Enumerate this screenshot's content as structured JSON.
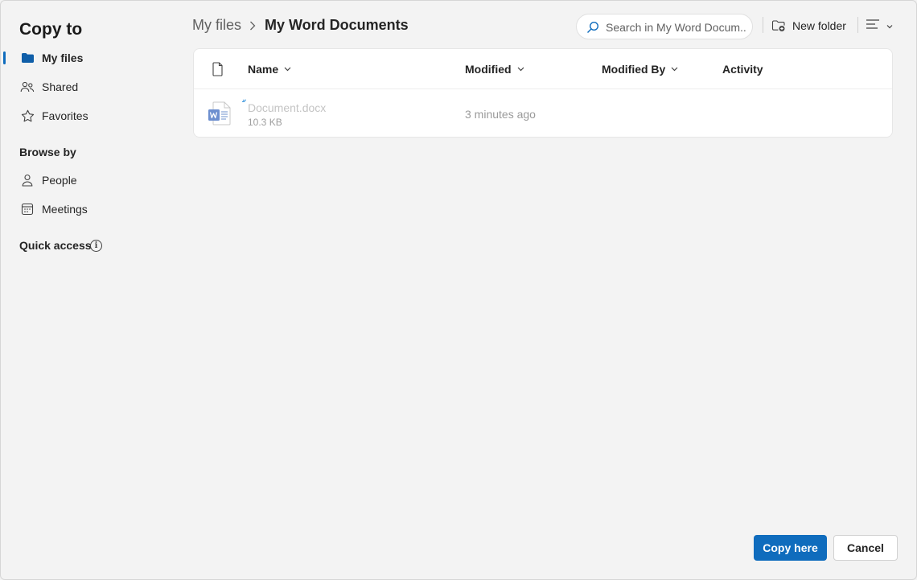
{
  "dialog": {
    "title": "Copy to"
  },
  "sidebar": {
    "items": [
      {
        "label": "My files",
        "icon": "folder-icon",
        "active": true
      },
      {
        "label": "Shared",
        "icon": "people-shared-icon",
        "active": false
      },
      {
        "label": "Favorites",
        "icon": "star-icon",
        "active": false
      }
    ],
    "browse_by_title": "Browse by",
    "browse_items": [
      {
        "label": "People",
        "icon": "person-icon"
      },
      {
        "label": "Meetings",
        "icon": "calendar-icon"
      }
    ],
    "quick_access_title": "Quick access"
  },
  "breadcrumb": {
    "root": "My files",
    "current": "My Word Documents"
  },
  "search": {
    "placeholder": "Search in My Word Docum..."
  },
  "toolbar": {
    "new_folder_label": "New folder"
  },
  "table": {
    "columns": {
      "name": "Name",
      "modified": "Modified",
      "modified_by": "Modified By",
      "activity": "Activity"
    },
    "rows": [
      {
        "name": "Document.docx",
        "size": "10.3 KB",
        "modified": "3 minutes ago",
        "modified_by": "",
        "activity": ""
      }
    ]
  },
  "footer": {
    "primary_label": "Copy here",
    "secondary_label": "Cancel"
  },
  "colors": {
    "accent": "#0f6cbd",
    "background": "#f3f3f3",
    "card": "#ffffff",
    "word_blue": "#2b579a"
  }
}
